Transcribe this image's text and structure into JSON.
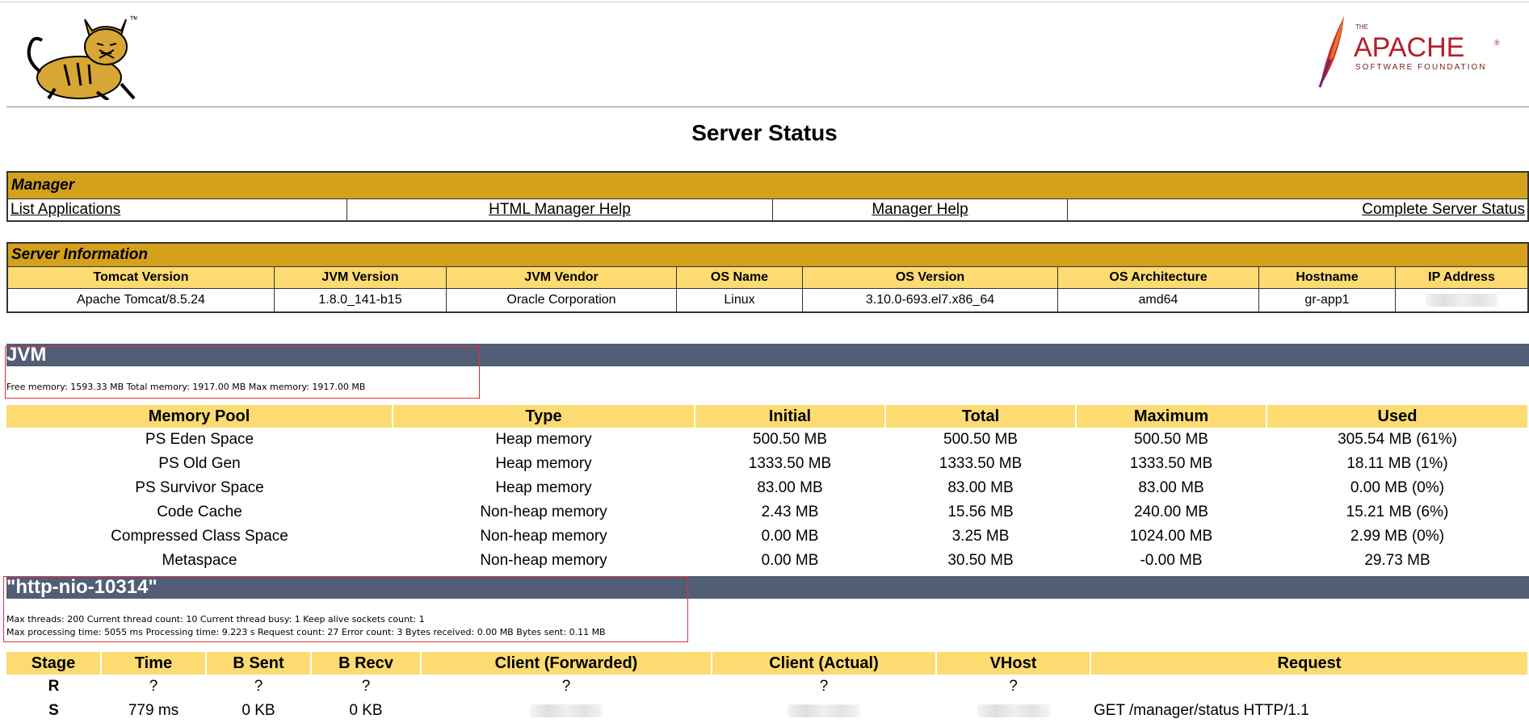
{
  "page_title": "Server Status",
  "logos": {
    "tomcat_tm": "™",
    "apache_the": "THE",
    "apache_name": "APACHE",
    "apache_reg": "®",
    "apache_sub": "SOFTWARE FOUNDATION"
  },
  "manager": {
    "heading": "Manager",
    "links": [
      "List Applications",
      "HTML Manager Help",
      "Manager Help",
      "Complete Server Status"
    ]
  },
  "server_info": {
    "heading": "Server Information",
    "headers": [
      "Tomcat Version",
      "JVM Version",
      "JVM Vendor",
      "OS Name",
      "OS Version",
      "OS Architecture",
      "Hostname",
      "IP Address"
    ],
    "values": [
      "Apache Tomcat/8.5.24",
      "1.8.0_141-b15",
      "Oracle Corporation",
      "Linux",
      "3.10.0-693.el7.x86_64",
      "amd64",
      "gr-app1",
      ""
    ]
  },
  "jvm": {
    "heading": "JVM",
    "memory_line": "Free memory: 1593.33 MB Total memory: 1917.00 MB Max memory: 1917.00 MB"
  },
  "memory_pools": {
    "headers": [
      "Memory Pool",
      "Type",
      "Initial",
      "Total",
      "Maximum",
      "Used"
    ],
    "rows": [
      [
        "PS Eden Space",
        "Heap memory",
        "500.50 MB",
        "500.50 MB",
        "500.50 MB",
        "305.54 MB (61%)"
      ],
      [
        "PS Old Gen",
        "Heap memory",
        "1333.50 MB",
        "1333.50 MB",
        "1333.50 MB",
        "18.11 MB (1%)"
      ],
      [
        "PS Survivor Space",
        "Heap memory",
        "83.00 MB",
        "83.00 MB",
        "83.00 MB",
        "0.00 MB (0%)"
      ],
      [
        "Code Cache",
        "Non-heap memory",
        "2.43 MB",
        "15.56 MB",
        "240.00 MB",
        "15.21 MB (6%)"
      ],
      [
        "Compressed Class Space",
        "Non-heap memory",
        "0.00 MB",
        "3.25 MB",
        "1024.00 MB",
        "2.99 MB (0%)"
      ],
      [
        "Metaspace",
        "Non-heap memory",
        "0.00 MB",
        "30.50 MB",
        "-0.00 MB",
        "29.73 MB"
      ]
    ]
  },
  "connector": {
    "heading": "\"http-nio-10314\"",
    "line1": "Max threads: 200 Current thread count: 10 Current thread busy: 1 Keep alive sockets count: 1",
    "line2": "Max processing time: 5055 ms Processing time: 9.223 s Request count: 27 Error count: 3 Bytes received: 0.00 MB Bytes sent: 0.11 MB"
  },
  "requests": {
    "headers": [
      "Stage",
      "Time",
      "B Sent",
      "B Recv",
      "Client (Forwarded)",
      "Client (Actual)",
      "VHost",
      "Request"
    ],
    "rows": [
      [
        "R",
        "?",
        "?",
        "?",
        "?",
        "?",
        "?",
        ""
      ],
      [
        "S",
        "779 ms",
        "0 KB",
        "0 KB",
        "",
        "",
        "",
        "GET /manager/status HTTP/1.1"
      ]
    ]
  },
  "colors": {
    "section_header": "#d3a11c",
    "table_header": "#fcdb72",
    "band": "#525d76",
    "highlight_box": "#e0303a"
  }
}
